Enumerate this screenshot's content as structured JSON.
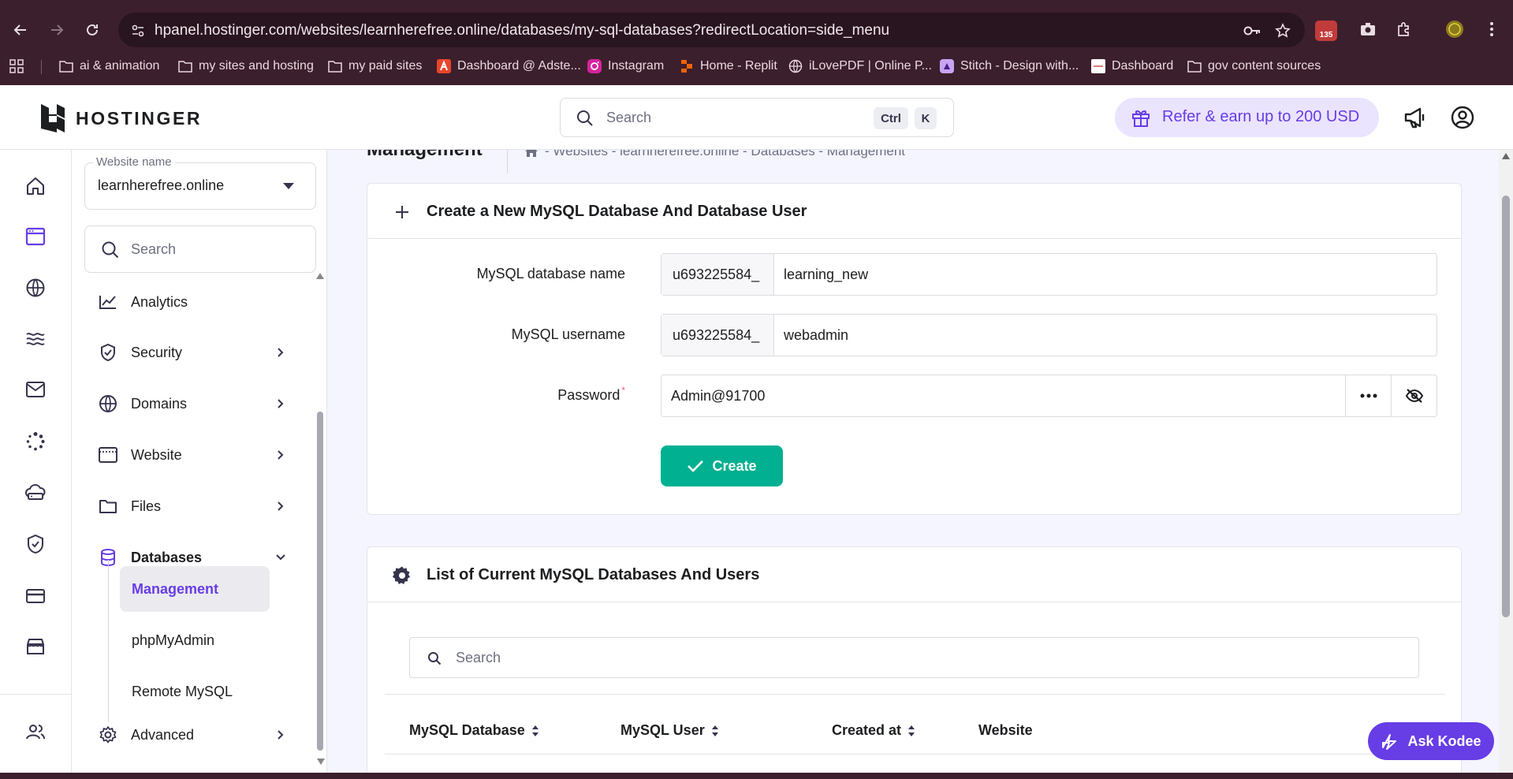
{
  "browser": {
    "url": "hpanel.hostinger.com/websites/learnherefree.online/databases/my-sql-databases?redirectLocation=side_menu",
    "extension_badge": "135",
    "bookmarks": [
      {
        "label": "ai & animation",
        "icon": "folder-icon"
      },
      {
        "label": "my sites and hosting",
        "icon": "folder-icon"
      },
      {
        "label": "my paid sites",
        "icon": "folder-icon"
      },
      {
        "label": "Dashboard @ Adste...",
        "icon": "adsterra-icon"
      },
      {
        "label": "Instagram",
        "icon": "instagram-icon"
      },
      {
        "label": "Home - Replit",
        "icon": "replit-icon"
      },
      {
        "label": "iLovePDF | Online P...",
        "icon": "globe-icon"
      },
      {
        "label": "Stitch - Design with...",
        "icon": "stitch-icon"
      },
      {
        "label": "Dashboard",
        "icon": "dashboard-favicon"
      },
      {
        "label": "gov content sources",
        "icon": "folder-icon"
      }
    ]
  },
  "header": {
    "logo_text": "HOSTINGER",
    "search_placeholder": "Search",
    "shortcut_ctrl": "Ctrl",
    "shortcut_key": "K",
    "refer_label": "Refer & earn up to 200 USD"
  },
  "sidebar": {
    "website_label": "Website name",
    "website_value": "learnherefree.online",
    "search_placeholder": "Search",
    "items": [
      {
        "label": "Analytics",
        "icon": "analytics-icon"
      },
      {
        "label": "Security",
        "icon": "shield-icon"
      },
      {
        "label": "Domains",
        "icon": "globe-icon"
      },
      {
        "label": "Website",
        "icon": "browser-icon"
      },
      {
        "label": "Files",
        "icon": "folder-icon"
      },
      {
        "label": "Databases",
        "icon": "database-icon"
      },
      {
        "label": "Advanced",
        "icon": "gear-icon"
      }
    ],
    "sub_items": [
      {
        "label": "Management"
      },
      {
        "label": "phpMyAdmin"
      },
      {
        "label": "Remote MySQL"
      }
    ]
  },
  "page": {
    "title": "Management",
    "breadcrumb": "- Websites - learnherefree.online - Databases - Management"
  },
  "create_card": {
    "heading": "Create a New MySQL Database And Database User",
    "db_name_label": "MySQL database name",
    "db_prefix": "u693225584_",
    "db_name_value": "learning_new",
    "username_label": "MySQL username",
    "user_prefix": "u693225584_",
    "username_value": "webadmin",
    "password_label": "Password",
    "password_required_mark": "*",
    "password_value": "Admin@91700",
    "create_label": "Create"
  },
  "list_card": {
    "heading": "List of Current MySQL Databases And Users",
    "search_placeholder": "Search",
    "columns": [
      "MySQL Database",
      "MySQL User",
      "Created at",
      "Website"
    ]
  },
  "kodee_label": "Ask Kodee",
  "colors": {
    "brand": "#673de6",
    "create": "#00b090",
    "chrome": "#3c1f2c"
  }
}
